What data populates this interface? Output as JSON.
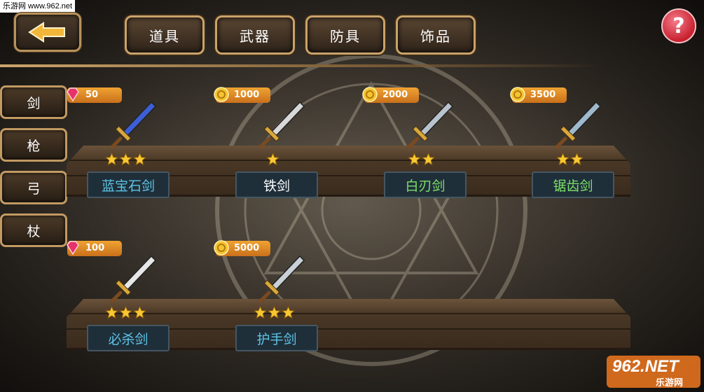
{
  "watermark_top": "乐游网 www.962.net",
  "watermark_bottom": {
    "brand": "962.NET",
    "sub": "乐游网"
  },
  "tabs": [
    "道具",
    "武器",
    "防具",
    "饰品"
  ],
  "help_label": "?",
  "categories": [
    "剑",
    "枪",
    "弓",
    "杖"
  ],
  "colors": {
    "gold_border": "#c9a36a",
    "price_bg": "#e08a26",
    "name_blue": "#5ec4e6",
    "name_white": "#ffffff",
    "name_green": "#7ee06a"
  },
  "items": [
    {
      "name": "蓝宝石剑",
      "currency": "gem-icon",
      "price": "50",
      "stars": 3,
      "name_color": "#5ec4e6",
      "blade": "#3d5fd6"
    },
    {
      "name": "铁剑",
      "currency": "coin-icon",
      "price": "1000",
      "stars": 1,
      "name_color": "#ffffff",
      "blade": "#d8d8d8"
    },
    {
      "name": "白刃剑",
      "currency": "coin-icon",
      "price": "2000",
      "stars": 2,
      "name_color": "#7ee06a",
      "blade": "#b8c3cc"
    },
    {
      "name": "锯齿剑",
      "currency": "coin-icon",
      "price": "3500",
      "stars": 2,
      "name_color": "#7ee06a",
      "blade": "#9fb9cc"
    },
    {
      "name": "必杀剑",
      "currency": "gem-icon",
      "price": "100",
      "stars": 3,
      "name_color": "#5ec4e6",
      "blade": "#e6e6e6"
    },
    {
      "name": "护手剑",
      "currency": "coin-icon",
      "price": "5000",
      "stars": 3,
      "name_color": "#5ec4e6",
      "blade": "#c9d0d6"
    }
  ]
}
